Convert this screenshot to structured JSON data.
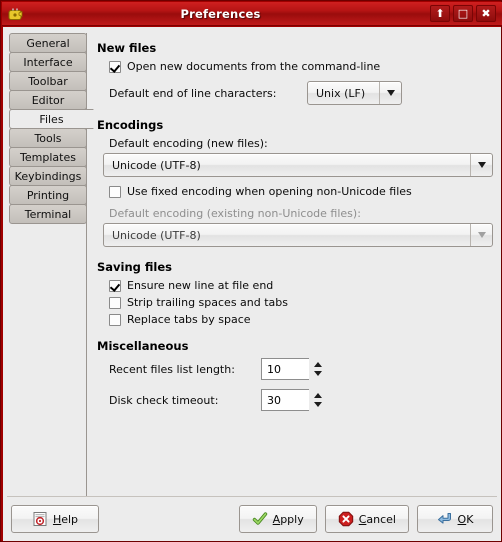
{
  "window": {
    "title": "Preferences",
    "app_icon": "geany-icon",
    "controls": [
      {
        "name": "shade-button",
        "glyph": "⬆"
      },
      {
        "name": "maximize-button",
        "glyph": "□"
      },
      {
        "name": "close-button",
        "glyph": "✖"
      }
    ],
    "accent_color": "#a00000",
    "bg_color": "#ececec"
  },
  "sidebar": {
    "selected": "Files",
    "items": [
      {
        "label": "General"
      },
      {
        "label": "Interface"
      },
      {
        "label": "Toolbar"
      },
      {
        "label": "Editor"
      },
      {
        "label": "Files"
      },
      {
        "label": "Tools"
      },
      {
        "label": "Templates"
      },
      {
        "label": "Keybindings"
      },
      {
        "label": "Printing"
      },
      {
        "label": "Terminal"
      }
    ]
  },
  "page": {
    "new_files": {
      "title": "New files",
      "open_from_cmdline": {
        "label": "Open new documents from the command-line",
        "checked": true
      },
      "eol_label": "Default end of line characters:",
      "eol_value": "Unix (LF)"
    },
    "encodings": {
      "title": "Encodings",
      "new_label": "Default encoding (new files):",
      "new_value": "Unicode (UTF-8)",
      "fixed_encoding": {
        "label": "Use fixed encoding when opening non-Unicode files",
        "checked": false
      },
      "existing_label": "Default encoding (existing non-Unicode files):",
      "existing_value": "Unicode (UTF-8)",
      "existing_disabled": true
    },
    "saving_files": {
      "title": "Saving files",
      "options": [
        {
          "label": "Ensure new line at file end",
          "checked": true
        },
        {
          "label": "Strip trailing spaces and tabs",
          "checked": false
        },
        {
          "label": "Replace tabs by space",
          "checked": false
        }
      ]
    },
    "miscellaneous": {
      "title": "Miscellaneous",
      "recent_label": "Recent files list length:",
      "recent_value": "10",
      "disk_label": "Disk check timeout:",
      "disk_value": "30"
    }
  },
  "actions": {
    "help": {
      "label": "Help",
      "mnemonic": "H",
      "icon": "help-icon"
    },
    "apply": {
      "label": "Apply",
      "mnemonic": "A",
      "icon": "check-icon"
    },
    "cancel": {
      "label": "Cancel",
      "mnemonic": "C",
      "icon": "stop-icon"
    },
    "ok": {
      "label": "OK",
      "mnemonic": "O",
      "icon": "enter-arrow-icon"
    }
  }
}
